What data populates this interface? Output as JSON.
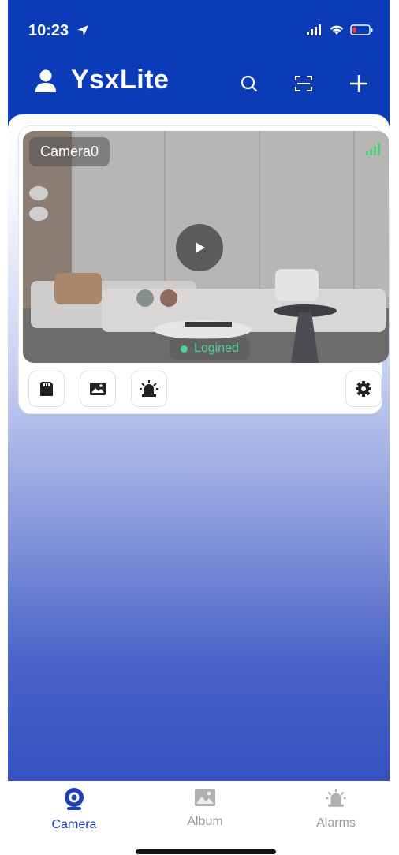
{
  "status_bar": {
    "time": "10:23"
  },
  "header": {
    "title": "YsxLite"
  },
  "camera_card": {
    "name": "Camera0",
    "status": "Logined",
    "status_color": "#49d49a"
  },
  "tabs": [
    {
      "label": "Camera",
      "active": true,
      "color": "#1f3fb8"
    },
    {
      "label": "Album",
      "active": false,
      "color": "#9a9a9a"
    },
    {
      "label": "Alarms",
      "active": false,
      "color": "#9a9a9a"
    }
  ],
  "colors": {
    "brand_blue": "#0b3bb6"
  }
}
